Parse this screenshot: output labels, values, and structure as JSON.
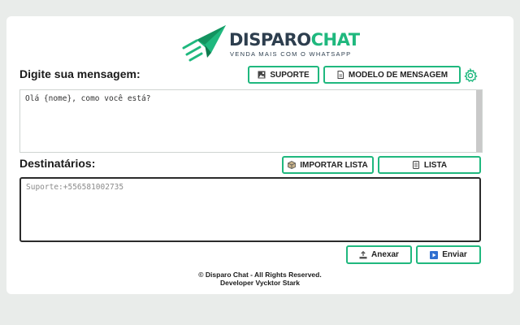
{
  "brand": {
    "word_primary": "DISPARO",
    "word_accent": "CHAT",
    "tagline": "VENDA MAIS COM O WHATSAPP",
    "colors": {
      "accent": "#1fb87e",
      "dark": "#2d3e4e"
    }
  },
  "message": {
    "heading": "Digite sua mensagem:",
    "value": "Olá {nome}, como você está?",
    "support_button": {
      "label": "SUPORTE",
      "icon": "image-icon"
    },
    "template_button": {
      "label": "MODELO DE MENSAGEM",
      "icon": "document-icon"
    },
    "settings_icon": "gear-icon"
  },
  "recipients": {
    "heading": "Destinatários:",
    "placeholder": "Suporte:+556581002735",
    "import_button": {
      "label": "IMPORTAR LISTA",
      "icon": "box-icon"
    },
    "list_button": {
      "label": "LISTA",
      "icon": "list-icon"
    }
  },
  "actions": {
    "attach_label": "Anexar",
    "send_label": "Enviar"
  },
  "footer": {
    "line1": "© Disparo Chat - All Rights Reserved.",
    "line2": "Developer Vycktor Stark"
  }
}
